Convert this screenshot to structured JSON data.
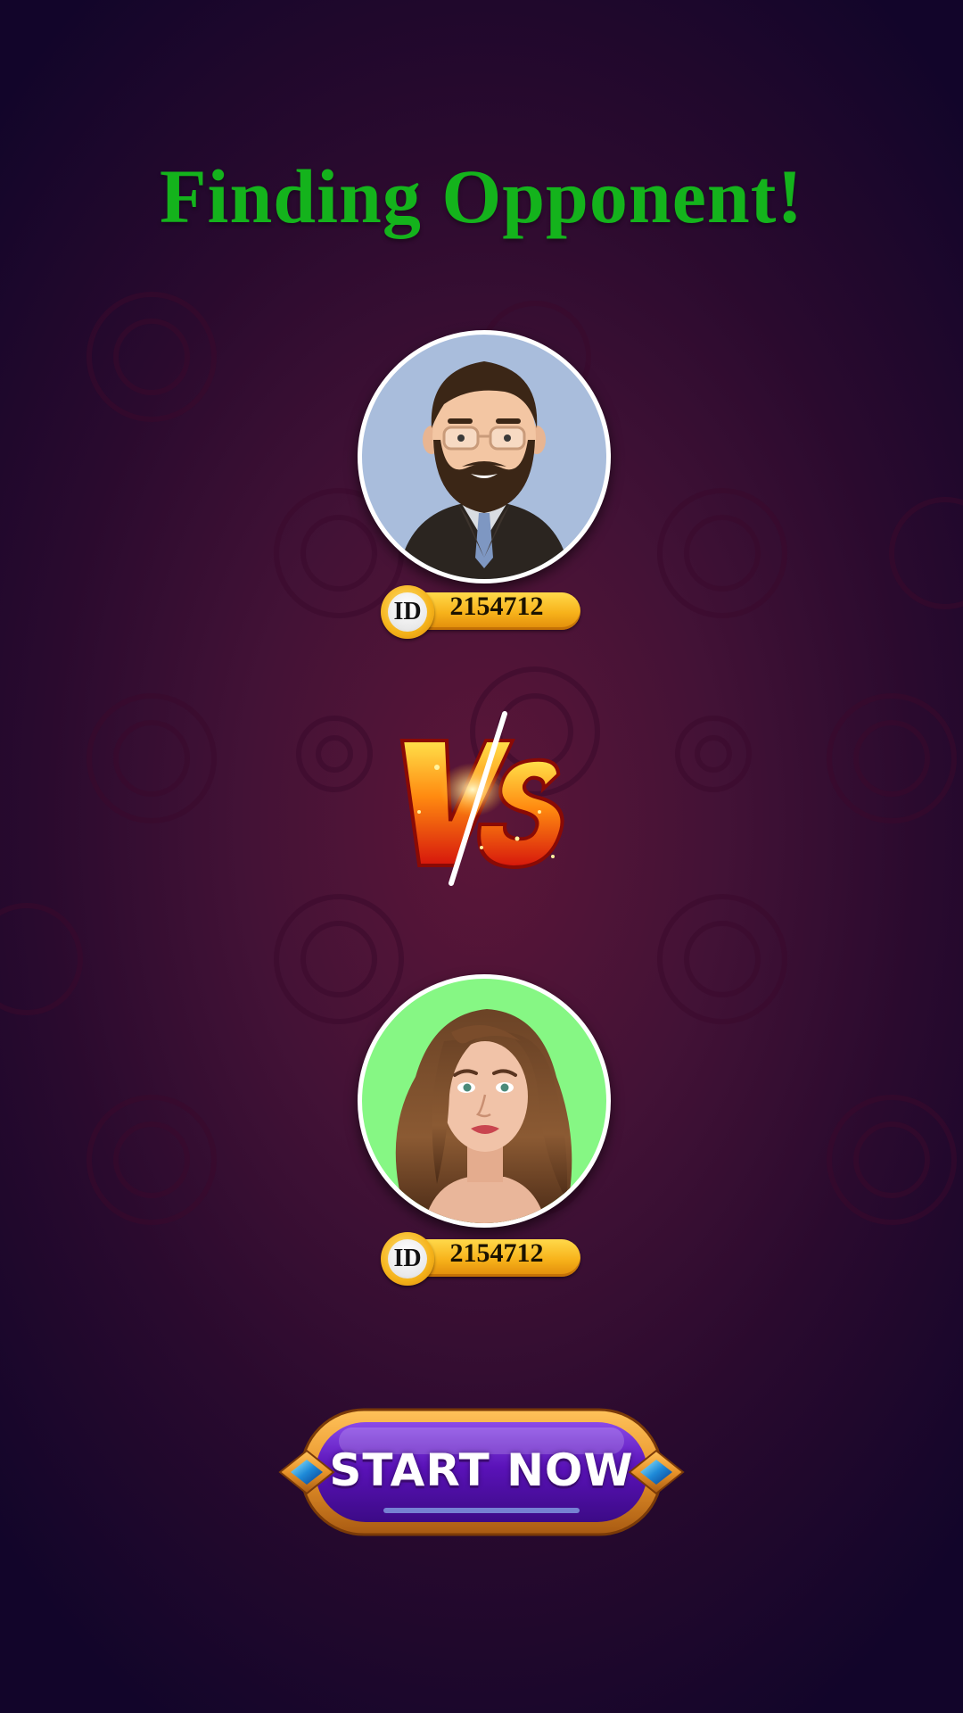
{
  "screen": {
    "title": "Finding Opponent!"
  },
  "players": [
    {
      "role": "player",
      "avatar_icon": "bearded-man-avatar",
      "id_label": "ID",
      "id_value": "2154712"
    },
    {
      "role": "opponent",
      "avatar_icon": "long-haired-woman-avatar",
      "id_label": "ID",
      "id_value": "2154712"
    }
  ],
  "versus": {
    "icon": "vs-emblem"
  },
  "start_button": {
    "label": "START NOW"
  },
  "colors": {
    "title": "#14b31c",
    "background_center": "#5c1638",
    "background_edge": "#12052a",
    "player_avatar_bg": "#a9bddc",
    "opponent_avatar_bg": "#86f784",
    "id_badge": "#f7b21a",
    "button_fill": "#5a12b8",
    "button_frame": "#e8942a"
  }
}
